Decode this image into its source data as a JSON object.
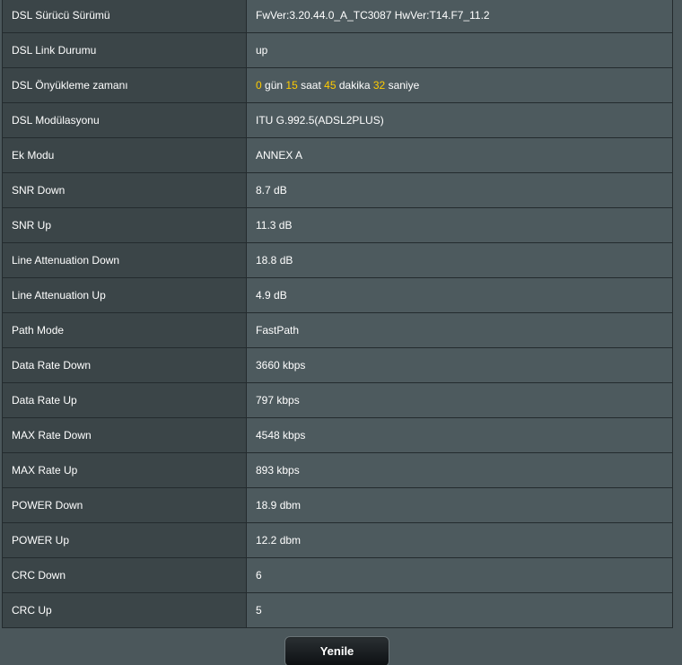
{
  "rows": [
    {
      "label": "DSL Sürücü Sürümü",
      "value": "FwVer:3.20.44.0_A_TC3087 HwVer:T14.F7_11.2"
    },
    {
      "label": "DSL Link Durumu",
      "value": "up"
    },
    {
      "label": "DSL Önyükleme zamanı",
      "uptime": {
        "days": "0",
        "days_unit": "gün",
        "hours": "15",
        "hours_unit": "saat",
        "minutes": "45",
        "minutes_unit": "dakika",
        "seconds": "32",
        "seconds_unit": "saniye"
      }
    },
    {
      "label": "DSL Modülasyonu",
      "value": "ITU G.992.5(ADSL2PLUS)"
    },
    {
      "label": "Ek Modu",
      "value": "ANNEX A"
    },
    {
      "label": "SNR Down",
      "value": "8.7 dB"
    },
    {
      "label": "SNR Up",
      "value": "11.3 dB"
    },
    {
      "label": "Line Attenuation Down",
      "value": "18.8 dB"
    },
    {
      "label": "Line Attenuation Up",
      "value": "4.9 dB"
    },
    {
      "label": "Path Mode",
      "value": "FastPath"
    },
    {
      "label": "Data Rate Down",
      "value": "3660 kbps"
    },
    {
      "label": "Data Rate Up",
      "value": "797 kbps"
    },
    {
      "label": "MAX Rate Down",
      "value": "4548 kbps"
    },
    {
      "label": "MAX Rate Up",
      "value": "893 kbps"
    },
    {
      "label": "POWER Down",
      "value": "18.9 dbm"
    },
    {
      "label": "POWER Up",
      "value": "12.2 dbm"
    },
    {
      "label": "CRC Down",
      "value": "6"
    },
    {
      "label": "CRC Up",
      "value": "5"
    }
  ],
  "refresh_button": {
    "label": "Yenile"
  },
  "colors": {
    "highlight_number": "#ffcc00",
    "label_bg": "#3b4548",
    "value_bg": "#4d5a5e",
    "page_bg": "#4b575b"
  }
}
